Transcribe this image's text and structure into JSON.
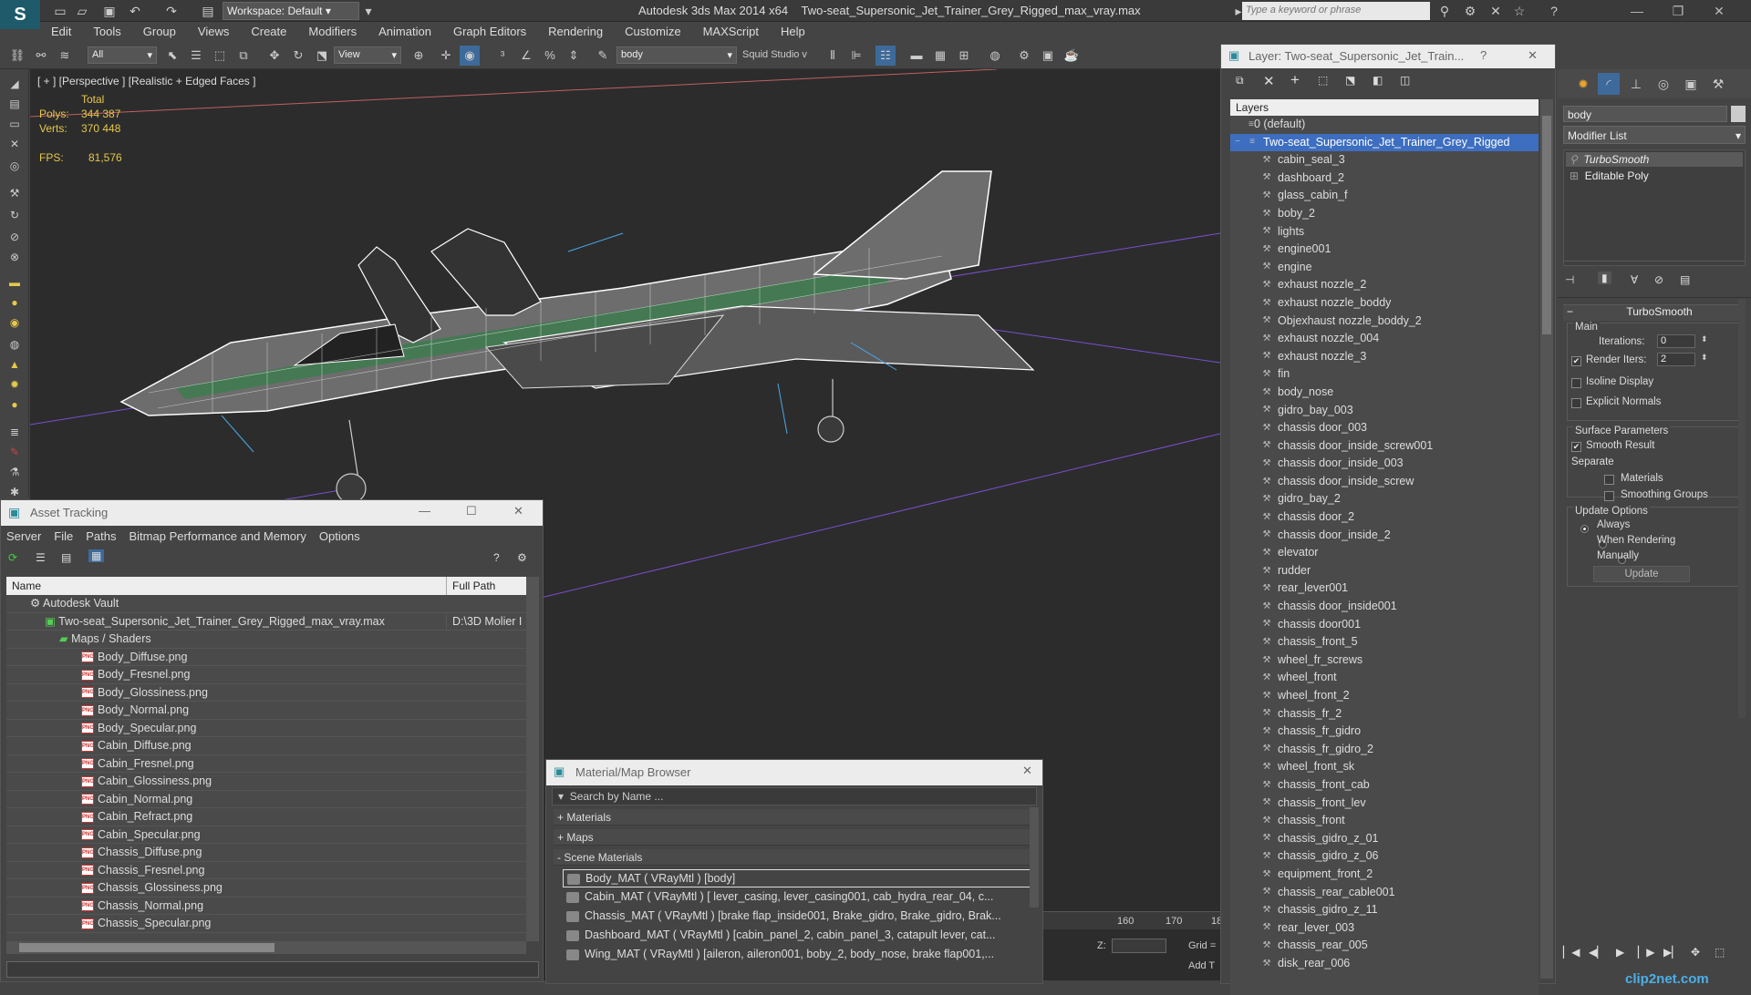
{
  "app": {
    "title": "Autodesk 3ds Max  2014 x64",
    "file": "Two-seat_Supersonic_Jet_Trainer_Grey_Rigged_max_vray.max",
    "workspace": "Workspace: Default",
    "keyword_placeholder": "Type a keyword or phrase"
  },
  "menu": [
    "Edit",
    "Tools",
    "Group",
    "Views",
    "Create",
    "Modifiers",
    "Animation",
    "Graph Editors",
    "Rendering",
    "Customize",
    "MAXScript",
    "Help"
  ],
  "toolbar": {
    "filter": "All",
    "ref_coord": "View",
    "named_selection": "body",
    "studio": "Squid Studio v"
  },
  "viewport": {
    "label": "[ + ] [Perspective ] [Realistic + Edged Faces ]",
    "total_label": "Total",
    "polys_label": "Polys:",
    "polys": "344 387",
    "verts_label": "Verts:",
    "verts": "370 448",
    "fps_label": "FPS:",
    "fps": "81,576"
  },
  "asset_tracking": {
    "title": "Asset Tracking",
    "menu": [
      "Server",
      "File",
      "Paths",
      "Bitmap Performance and Memory",
      "Options"
    ],
    "col_name": "Name",
    "col_path": "Full Path",
    "vault": "Autodesk Vault",
    "file": "Two-seat_Supersonic_Jet_Trainer_Grey_Rigged_max_vray.max",
    "file_path": "D:\\3D Molier I",
    "maps_folder": "Maps / Shaders",
    "png_tag": "PNG",
    "maps": [
      "Body_Diffuse.png",
      "Body_Fresnel.png",
      "Body_Glossiness.png",
      "Body_Normal.png",
      "Body_Specular.png",
      "Cabin_Diffuse.png",
      "Cabin_Fresnel.png",
      "Cabin_Glossiness.png",
      "Cabin_Normal.png",
      "Cabin_Refract.png",
      "Cabin_Specular.png",
      "Chassis_Diffuse.png",
      "Chassis_Fresnel.png",
      "Chassis_Glossiness.png",
      "Chassis_Normal.png",
      "Chassis_Specular.png"
    ]
  },
  "material_browser": {
    "title": "Material/Map Browser",
    "search_placeholder": "Search by Name ...",
    "sections": [
      "+ Materials",
      "+ Maps",
      "- Scene Materials"
    ],
    "materials": [
      "Body_MAT  ( VRayMtl )  [body]",
      "Cabin_MAT  ( VRayMtl )  [ lever_casing,  lever_casing001, cab_hydra_rear_04, c...",
      "Chassis_MAT  ( VRayMtl )  [brake flap_inside001, Brake_gidro, Brake_gidro, Brak...",
      "Dashboard_MAT  ( VRayMtl )  [cabin_panel_2, cabin_panel_3, catapult lever, cat...",
      "Wing_MAT  ( VRayMtl )  [aileron, aileron001, boby_2, body_nose, brake flap001,..."
    ]
  },
  "layers": {
    "title": "Layer: Two-seat_Supersonic_Jet_Train...",
    "help": "?",
    "column": "Layers",
    "default_layer": "0 (default)",
    "active_layer": "Two-seat_Supersonic_Jet_Trainer_Grey_Rigged",
    "objects": [
      "cabin_seal_3",
      "dashboard_2",
      "glass_cabin_f",
      "boby_2",
      "lights",
      "engine001",
      "engine",
      "exhaust nozzle_2",
      "exhaust nozzle_boddy",
      "Objexhaust nozzle_boddy_2",
      "exhaust nozzle_004",
      "exhaust nozzle_3",
      "fin",
      "body_nose",
      "gidro_bay_003",
      "chassis door_003",
      "chassis door_inside_screw001",
      "chassis door_inside_003",
      "chassis door_inside_screw",
      "gidro_bay_2",
      "chassis door_2",
      "chassis door_inside_2",
      "elevator",
      "rudder",
      "rear_lever001",
      "chassis door_inside001",
      "chassis door001",
      "chassis_front_5",
      "wheel_fr_screws",
      "wheel_front",
      "wheel_front_2",
      "chassis_fr_2",
      "chassis_fr_gidro",
      "chassis_fr_gidro_2",
      "wheel_front_sk",
      "chassis_front_cab",
      "chassis_front_lev",
      "chassis_front",
      "chassis_gidro_z_01",
      "chassis_gidro_z_06",
      "equipment_front_2",
      "chassis_rear_cable001",
      "chassis_gidro_z_11",
      "rear_lever_003",
      "chassis_rear_005",
      "disk_rear_006"
    ]
  },
  "command_panel": {
    "object_name": "body",
    "modifier_list": "Modifier List",
    "stack": [
      "TurboSmooth",
      "Editable Poly"
    ],
    "rollout_title": "TurboSmooth",
    "main_label": "Main",
    "iterations_label": "Iterations:",
    "iterations": "0",
    "render_iters_label": "Render Iters:",
    "render_iters": "2",
    "isoline": "Isoline Display",
    "explicit": "Explicit Normals",
    "surface_params": "Surface Parameters",
    "smooth_result": "Smooth Result",
    "separate": "Separate",
    "materials": "Materials",
    "smoothing_groups": "Smoothing Groups",
    "update_options": "Update Options",
    "always": "Always",
    "when_rendering": "When Rendering",
    "manually": "Manually",
    "update_button": "Update"
  },
  "timeline": {
    "ticks": [
      "160",
      "170",
      "18"
    ],
    "z_label": "Z:",
    "grid_label": "Grid =",
    "add_label": "Add T"
  },
  "watermark": "clip2net.com"
}
